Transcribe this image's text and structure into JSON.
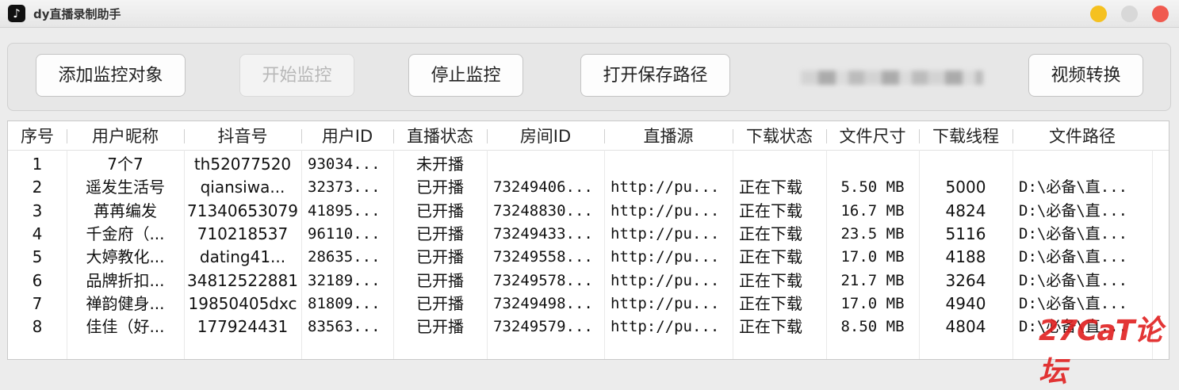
{
  "window": {
    "app_icon": "tiktok-icon",
    "title": "dy直播录制助手"
  },
  "toolbar": {
    "add_label": "添加监控对象",
    "start_label": "开始监控",
    "stop_label": "停止监控",
    "open_path_label": "打开保存路径",
    "convert_label": "视频转换"
  },
  "table": {
    "columns": [
      "序号",
      "用户昵称",
      "抖音号",
      "用户ID",
      "直播状态",
      "房间ID",
      "直播源",
      "下载状态",
      "文件尺寸",
      "下载线程",
      "文件路径"
    ],
    "rows": [
      [
        "1",
        "7个7",
        "th52077520",
        "93034...",
        "未开播",
        "",
        "",
        "",
        "",
        "",
        ""
      ],
      [
        "2",
        "遥发生活号",
        "qiansiwa...",
        "32373...",
        "已开播",
        "73249406...",
        "http://pu...",
        "正在下载",
        "5.50 MB",
        "5000",
        "D:\\必备\\直..."
      ],
      [
        "3",
        "苒苒编发",
        "71340653079",
        "41895...",
        "已开播",
        "73248830...",
        "http://pu...",
        "正在下载",
        "16.7 MB",
        "4824",
        "D:\\必备\\直..."
      ],
      [
        "4",
        "千金府（...",
        "710218537",
        "96110...",
        "已开播",
        "73249433...",
        "http://pu...",
        "正在下载",
        "23.5 MB",
        "5116",
        "D:\\必备\\直..."
      ],
      [
        "5",
        "大婷教化...",
        "dating41...",
        "28635...",
        "已开播",
        "73249558...",
        "http://pu...",
        "正在下载",
        "17.0 MB",
        "4188",
        "D:\\必备\\直..."
      ],
      [
        "6",
        "品牌折扣...",
        "34812522881",
        "32189...",
        "已开播",
        "73249578...",
        "http://pu...",
        "正在下载",
        "21.7 MB",
        "3264",
        "D:\\必备\\直..."
      ],
      [
        "7",
        "禅韵健身...",
        "19850405dxc",
        "81809...",
        "已开播",
        "73249498...",
        "http://pu...",
        "正在下载",
        "17.0 MB",
        "4940",
        "D:\\必备\\直..."
      ],
      [
        "8",
        "佳佳（好...",
        "177924431",
        "83563...",
        "已开播",
        "73249579...",
        "http://pu...",
        "正在下载",
        "8.50 MB",
        "4804",
        "D:\\必备\\直..."
      ]
    ]
  },
  "watermark": "27CaT论坛"
}
